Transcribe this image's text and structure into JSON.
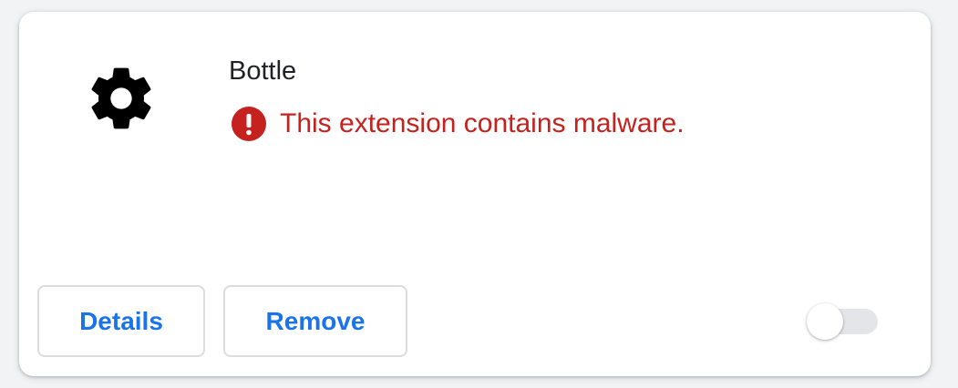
{
  "extension": {
    "name": "Bottle",
    "icon": "gear-icon",
    "warning": {
      "icon": "error-icon",
      "text": "This extension contains malware.",
      "color": "#c5221f"
    },
    "enabled": false
  },
  "actions": {
    "details_label": "Details",
    "remove_label": "Remove"
  },
  "colors": {
    "accent": "#1a73e8",
    "error": "#c5221f",
    "text": "#202124",
    "border": "#dadce0"
  }
}
